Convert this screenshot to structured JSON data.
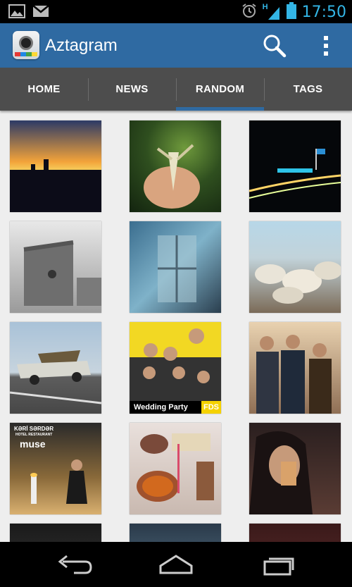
{
  "status_bar": {
    "time": "17:50",
    "left_icons": [
      "image-notification-icon",
      "gmail-notification-icon"
    ],
    "right_icons": [
      "alarm-icon",
      "signal-h-icon",
      "battery-icon"
    ],
    "network_type": "H"
  },
  "app": {
    "title": "Aztagram",
    "accent": "#2f6aa2"
  },
  "tabs": [
    {
      "label": "HOME",
      "active": false
    },
    {
      "label": "NEWS",
      "active": false
    },
    {
      "label": "RANDOM",
      "active": true
    },
    {
      "label": "TAGS",
      "active": false
    }
  ],
  "photos": [
    {
      "name": "sunset-skyline"
    },
    {
      "name": "praying-mantis"
    },
    {
      "name": "night-city-flag"
    },
    {
      "name": "maiden-tower"
    },
    {
      "name": "window-light"
    },
    {
      "name": "sheep-flock"
    },
    {
      "name": "old-car-with-tree"
    },
    {
      "name": "wedding-party-group",
      "caption": "Wedding Party",
      "badge": "FDS"
    },
    {
      "name": "three-friends"
    },
    {
      "name": "muse-restaurant",
      "sign_top": "KƏRİ SƏRDƏR",
      "sign_sub": "HOTEL RESTAURANT",
      "sign_main": "muse"
    },
    {
      "name": "desserts-table"
    },
    {
      "name": "selfie-girl"
    },
    {
      "name": "partial-1"
    },
    {
      "name": "partial-2"
    },
    {
      "name": "partial-3"
    }
  ],
  "nav_bar": {
    "buttons": [
      "back-icon",
      "home-icon",
      "recent-apps-icon"
    ]
  }
}
